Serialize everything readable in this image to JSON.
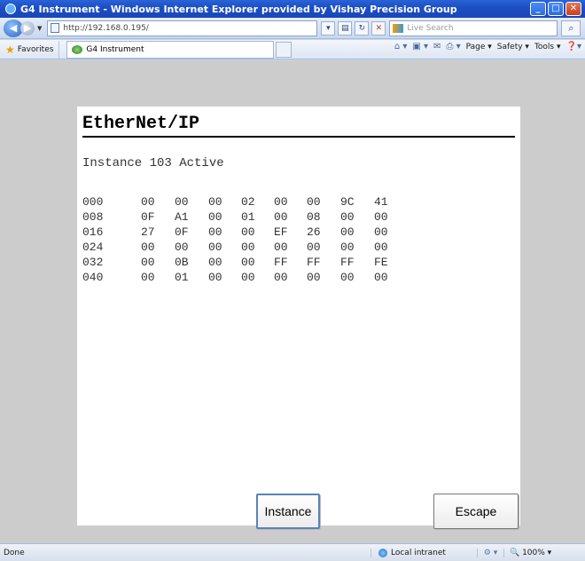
{
  "window": {
    "title": "G4 Instrument - Windows Internet Explorer provided by Vishay Precision Group"
  },
  "address": {
    "url": "http://192.168.0.195/",
    "search_placeholder": "Live Search"
  },
  "favorites": {
    "label": "Favorites",
    "tab_title": "G4 Instrument"
  },
  "commands": {
    "page": "Page ▾",
    "safety": "Safety ▾",
    "tools": "Tools ▾"
  },
  "page": {
    "heading": "EtherNet/IP",
    "status": "Instance 103 Active",
    "hex_rows": [
      [
        "000",
        "00",
        "00",
        "00",
        "02",
        "00",
        "00",
        "9C",
        "41"
      ],
      [
        "008",
        "0F",
        "A1",
        "00",
        "01",
        "00",
        "08",
        "00",
        "00"
      ],
      [
        "016",
        "27",
        "0F",
        "00",
        "00",
        "EF",
        "26",
        "00",
        "00"
      ],
      [
        "024",
        "00",
        "00",
        "00",
        "00",
        "00",
        "00",
        "00",
        "00"
      ],
      [
        "032",
        "00",
        "0B",
        "00",
        "00",
        "FF",
        "FF",
        "FF",
        "FE"
      ],
      [
        "040",
        "00",
        "01",
        "00",
        "00",
        "00",
        "00",
        "00",
        "00"
      ]
    ],
    "instance_button": "Instance",
    "escape_button": "Escape"
  },
  "statusbar": {
    "left": "Done",
    "zone": "Local intranet",
    "zoom": "100%"
  }
}
